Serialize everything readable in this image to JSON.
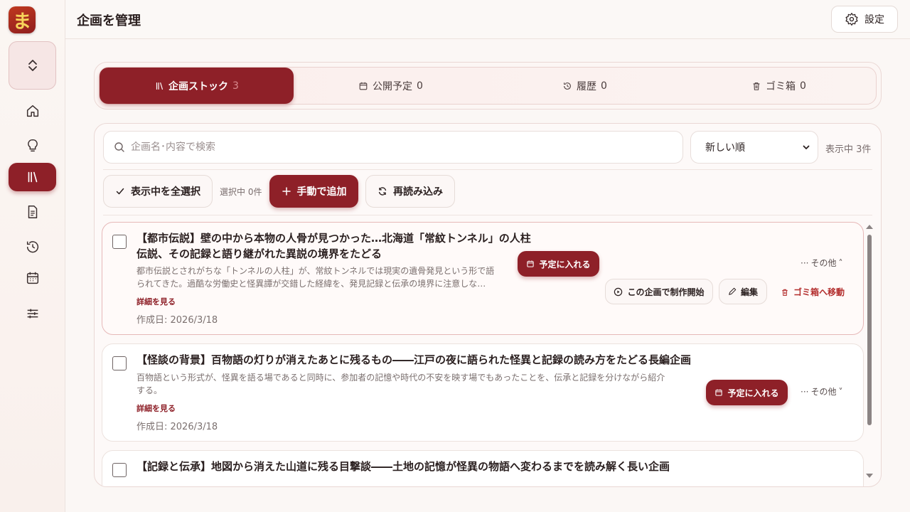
{
  "app": {
    "logo_char": "ま"
  },
  "header": {
    "title": "企画を管理",
    "settings_label": "設定"
  },
  "tabs": [
    {
      "label": "企画ストック",
      "count": "3",
      "icon": "library-icon",
      "active": true
    },
    {
      "label": "公開予定",
      "count": "0",
      "icon": "calendar-icon",
      "active": false
    },
    {
      "label": "履歴",
      "count": "0",
      "icon": "history-icon",
      "active": false
    },
    {
      "label": "ゴミ箱",
      "count": "0",
      "icon": "trash-icon",
      "active": false
    }
  ],
  "toolbar": {
    "search_placeholder": "企画名･内容で検索",
    "sort_value": "新しい順",
    "showing": "表示中 3件",
    "select_all_label": "表示中を全選択",
    "selected_count": "選択中 0件",
    "add_label": "手動で追加",
    "reload_label": "再読み込み"
  },
  "items": [
    {
      "title_line1": "【都市伝説】壁の中から本物の人骨が見つかった…北海道「常紋トンネル」の人柱",
      "title_line2": "伝説、その記録と語り継がれた異説の境界をたどる",
      "desc_line1": "都市伝説とされがちな「トンネルの人柱」が、常紋トンネルでは現実の遺骨発見という形で語",
      "desc_line2": "られてきた。過酷な労働史と怪異譚が交錯した経緯を、発見記録と伝承の境界に注意しな…",
      "detail_link": "詳細を見る",
      "created": "作成日: 2026/3/18",
      "schedule_label": "予定に入れる",
      "more_label": "その他",
      "start_label": "この企画で制作開始",
      "edit_label": "編集",
      "trash_label": "ゴミ箱へ移動"
    },
    {
      "title_line1": "【怪談の背景】百物語の灯りが消えたあとに残るもの――江戸の夜に語られた怪異と記録の読み方をたどる長編企画",
      "desc_line1": "百物語という形式が、怪異を語る場であると同時に、参加者の記憶や時代の不安を映す場でもあったことを、伝承と記録を分けながら紹介",
      "desc_line2": "する。",
      "detail_link": "詳細を見る",
      "created": "作成日: 2026/3/18",
      "schedule_label": "予定に入れる",
      "more_label": "その他"
    },
    {
      "title_line1": "【記録と伝承】地図から消えた山道に残る目撃談――土地の記憶が怪異の物語へ変わるまでを読み解く長い企画"
    }
  ],
  "colors": {
    "accent": "#8e2028",
    "danger": "#b32e2e",
    "background": "#fbf7f5"
  }
}
